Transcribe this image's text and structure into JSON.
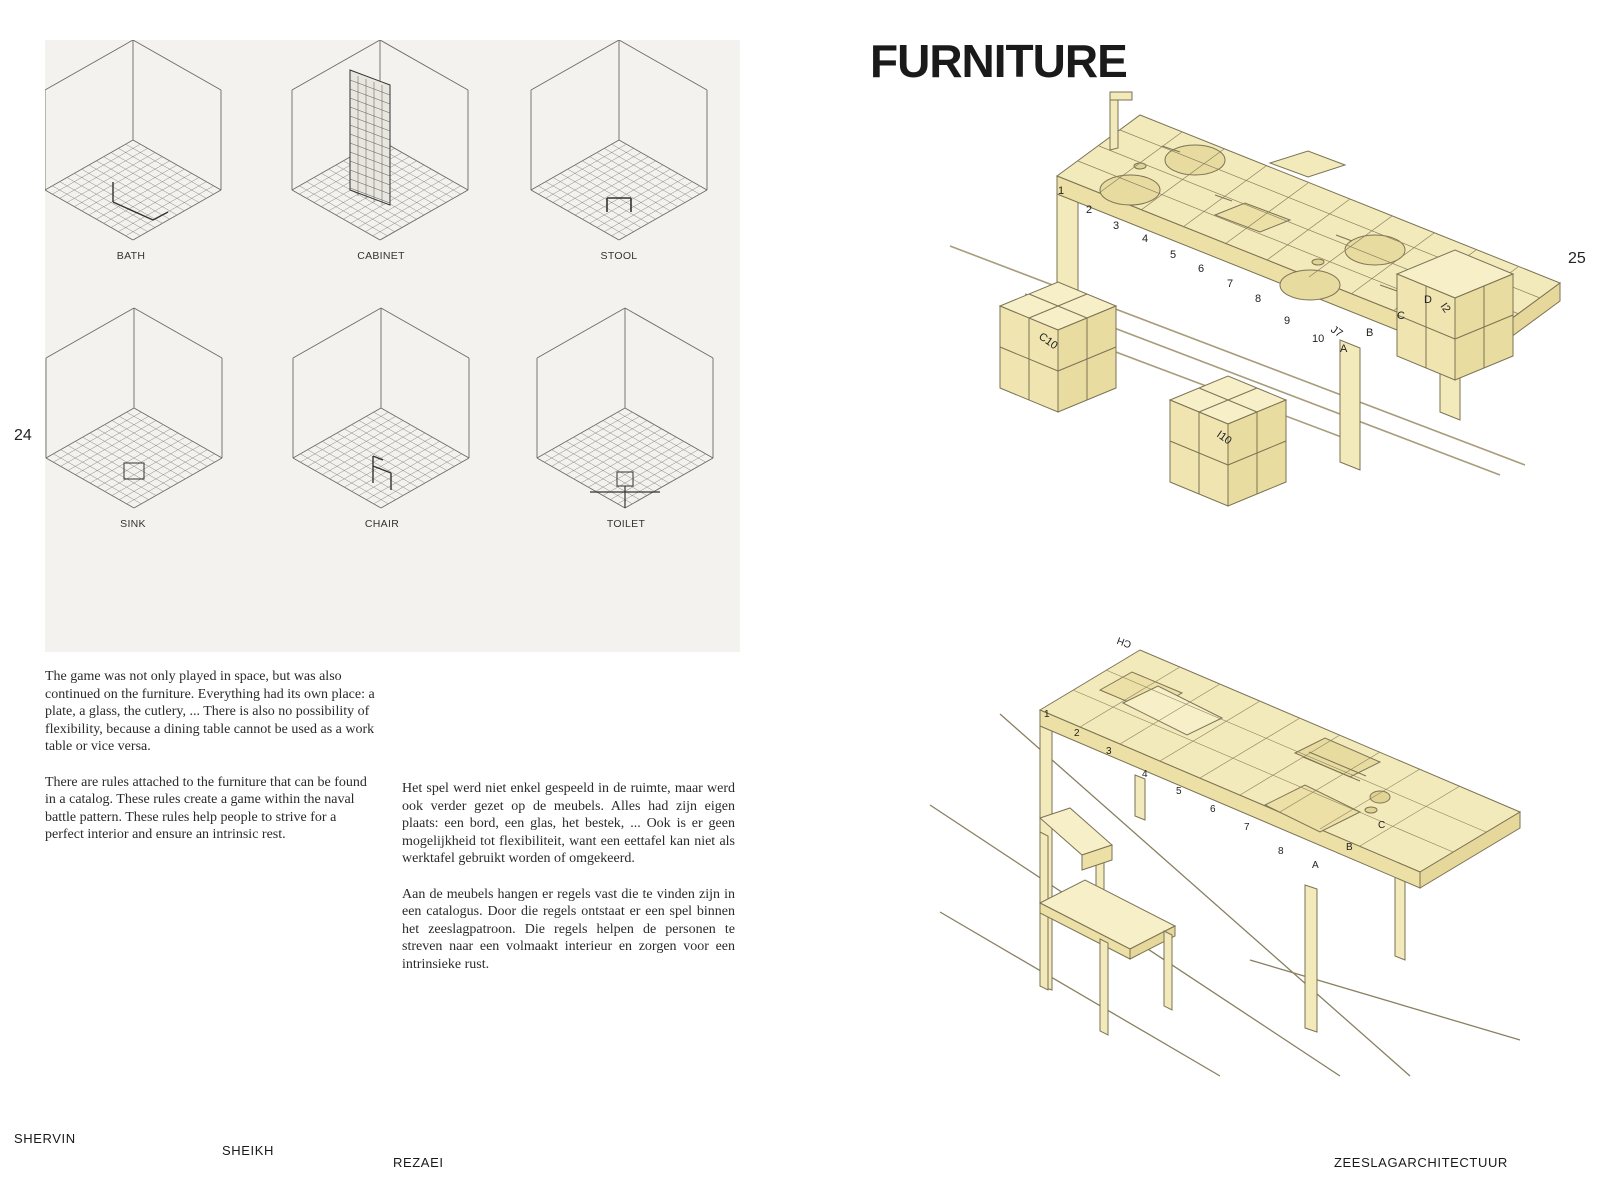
{
  "left_page": {
    "page_number": "24",
    "diagrams": [
      {
        "label": "BATH",
        "icon": "bath-outline"
      },
      {
        "label": "CABINET",
        "icon": "cabinet-grid-wall"
      },
      {
        "label": "STOOL",
        "icon": "stool"
      },
      {
        "label": "SINK",
        "icon": "sink"
      },
      {
        "label": "CHAIR",
        "icon": "chair"
      },
      {
        "label": "TOILET",
        "icon": "toilet"
      }
    ],
    "english_paragraphs": [
      "The game was not only played in space, but was also continued on the furniture. Everything had its own place: a plate, a glass, the cutlery, ... There is also no possibility of flexibility, because a dining table cannot be used as a work table or vice versa.",
      "There are rules attached to the furniture that can be found in a catalog. These rules create a game within the naval battle pattern. These rules help people to strive for a perfect interior and ensure an intrinsic rest."
    ],
    "dutch_paragraphs": [
      "Het spel werd niet enkel gespeeld in de ruimte, maar werd ook verder gezet op de meubels. Alles had zijn eigen plaats: een bord, een glas, het bestek, ... Ook is er geen mogelijkheid tot flexibiliteit, want een eettafel kan niet als werktafel gebruikt worden of omgekeerd.",
      "Aan de meubels hangen er regels vast die te vinden zijn in een catalogus. Door die regels ontstaat er een spel binnen het zeeslagpatroon. Die regels helpen de personen te streven naar een volmaakt interieur en zorgen voor een intrinsieke rust."
    ]
  },
  "right_page": {
    "title": "FURNITURE",
    "page_number": "25",
    "dining_table": {
      "top_numbers": [
        "1",
        "2",
        "3",
        "4",
        "5",
        "6",
        "7",
        "8",
        "9",
        "10"
      ],
      "top_letters": [
        "A",
        "B",
        "C",
        "D"
      ],
      "cube_labels": [
        "C10",
        "I10",
        "J7",
        "I2"
      ],
      "fill_color": "#f3eabb"
    },
    "work_desk": {
      "top_numbers": [
        "1",
        "2",
        "3",
        "4",
        "5",
        "6",
        "7",
        "8"
      ],
      "top_letters": [
        "A",
        "B",
        "C"
      ],
      "corner_label": "CH",
      "fill_color": "#f3eabb"
    }
  },
  "footer": {
    "name_first": "SHERVIN",
    "name_middle": "SHEIKH",
    "name_last": "REZAEI",
    "project": "ZEESLAGARCHITECTUUR"
  }
}
